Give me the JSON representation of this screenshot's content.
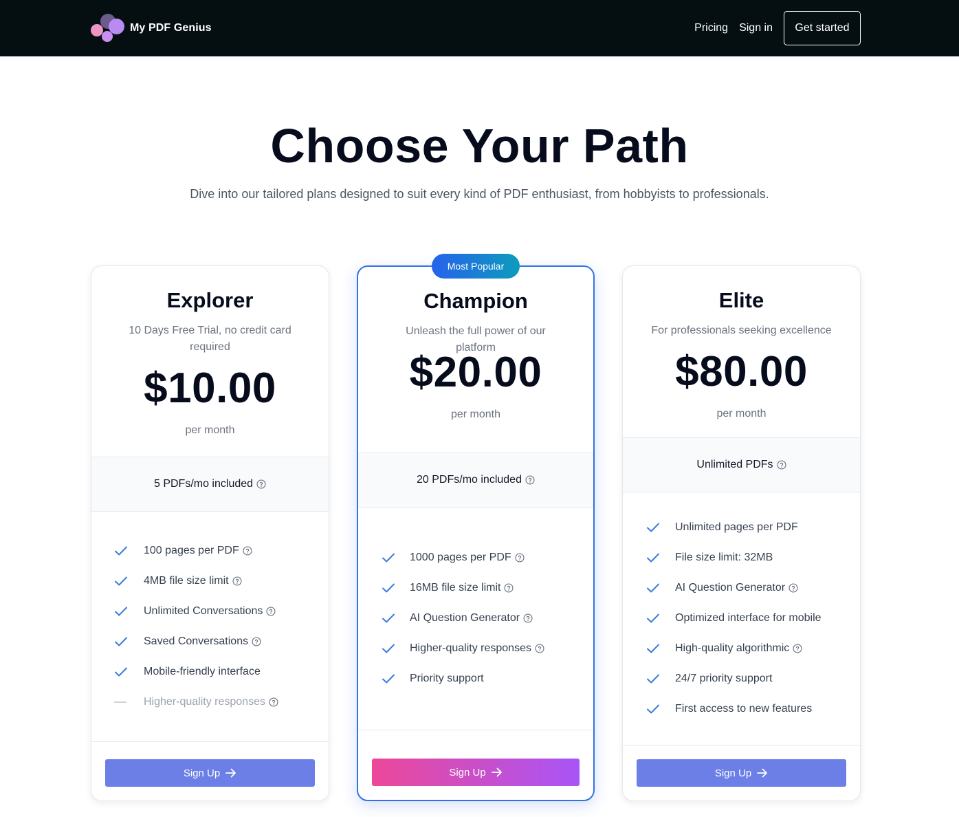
{
  "header": {
    "brand": "My PDF Genius",
    "nav": [
      "Pricing",
      "Sign in"
    ],
    "cta": "Get started"
  },
  "hero": {
    "title": "Choose Your Path",
    "subtitle": "Dive into our tailored plans designed to suit every kind of PDF enthusiast, from hobbyists to professionals."
  },
  "plans": [
    {
      "name": "Explorer",
      "description": "10 Days Free Trial, no credit card required",
      "price": "$10.00",
      "period": "per month",
      "quota": "5 PDFs/mo included",
      "features": [
        {
          "label": "100 pages per PDF",
          "included": true,
          "help": true
        },
        {
          "label": "4MB file size limit",
          "included": true,
          "help": true
        },
        {
          "label": "Unlimited Conversations",
          "included": true,
          "help": true
        },
        {
          "label": "Saved Conversations",
          "included": true,
          "help": true
        },
        {
          "label": "Mobile-friendly interface",
          "included": true,
          "help": false
        },
        {
          "label": "Higher-quality responses",
          "included": false,
          "help": true
        }
      ],
      "button": "Sign Up"
    },
    {
      "name": "Champion",
      "badge": "Most Popular",
      "description": "Unleash the full power of our platform",
      "price": "$20.00",
      "period": "per month",
      "quota": "20 PDFs/mo included",
      "features": [
        {
          "label": "1000 pages per PDF",
          "included": true,
          "help": true
        },
        {
          "label": "16MB file size limit",
          "included": true,
          "help": true
        },
        {
          "label": "AI Question Generator",
          "included": true,
          "help": true
        },
        {
          "label": "Higher-quality responses",
          "included": true,
          "help": true
        },
        {
          "label": "Priority support",
          "included": true,
          "help": false
        }
      ],
      "button": "Sign Up"
    },
    {
      "name": "Elite",
      "description": "For professionals seeking excellence",
      "price": "$80.00",
      "period": "per month",
      "quota": "Unlimited PDFs",
      "features": [
        {
          "label": "Unlimited pages per PDF",
          "included": true,
          "help": false
        },
        {
          "label": "File size limit: 32MB",
          "included": true,
          "help": false
        },
        {
          "label": "AI Question Generator",
          "included": true,
          "help": true
        },
        {
          "label": "Optimized interface for mobile",
          "included": true,
          "help": false
        },
        {
          "label": "High-quality algorithmic",
          "included": true,
          "help": true
        },
        {
          "label": "24/7 priority support",
          "included": true,
          "help": false
        },
        {
          "label": "First access to new features",
          "included": true,
          "help": false
        }
      ],
      "button": "Sign Up"
    }
  ],
  "colors": {
    "nav_bg": "#050f12",
    "check": "#3b7be0",
    "champion_border": "#3371e6",
    "signup_solid": "#6b7fe6",
    "signup_gradient": [
      "#ec4899",
      "#a855f7"
    ],
    "badge_gradient": [
      "#2563eb",
      "#0d9bbd"
    ]
  }
}
